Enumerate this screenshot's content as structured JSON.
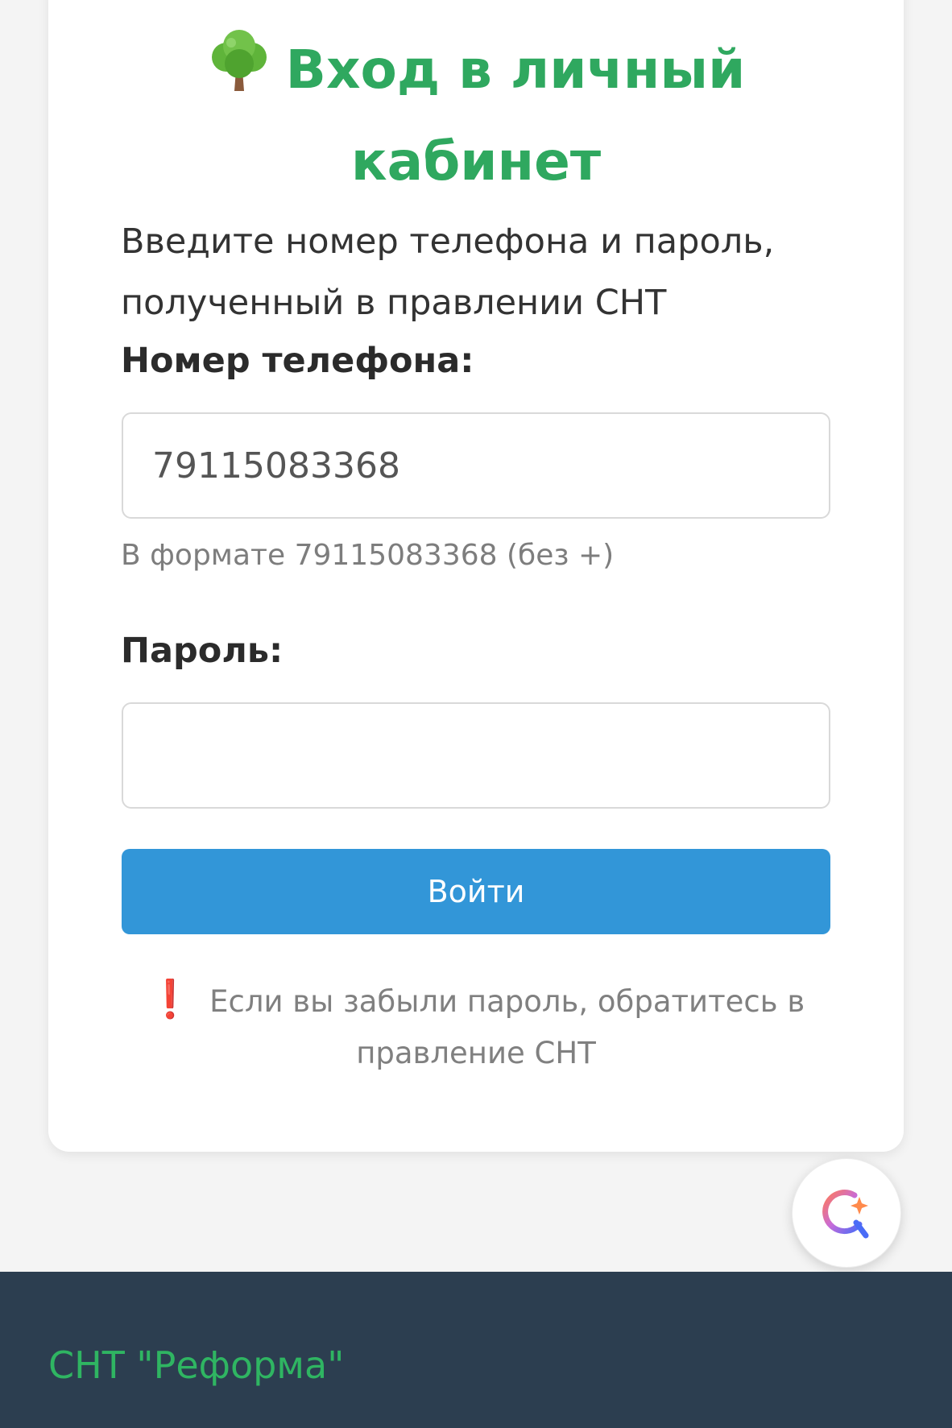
{
  "login": {
    "title_line1": "Вход в личный",
    "title_line2": "кабинет",
    "intro_line1": "Введите номер телефона и пароль,",
    "intro_line2": "полученный в правлении СНТ",
    "phone_label": "Номер телефона:",
    "phone_value": "79115083368",
    "phone_hint": "В формате 79115083368 (без +)",
    "password_label": "Пароль:",
    "password_value": "",
    "submit_label": "Войти",
    "forgot_line1": "Если вы забыли пароль, обратитесь в",
    "forgot_line2": "правление СНТ"
  },
  "icons": {
    "title_icon": "tree-icon",
    "forgot_icon": "exclamation-icon",
    "assistant_icon": "assistant-icon"
  },
  "footer": {
    "brand": "СНТ \"Реформа\""
  },
  "colors": {
    "accent_green": "#2fa85f",
    "button_blue": "#3296d8",
    "footer_bg": "#2c3e50",
    "warning_red": "#e03a3a"
  }
}
